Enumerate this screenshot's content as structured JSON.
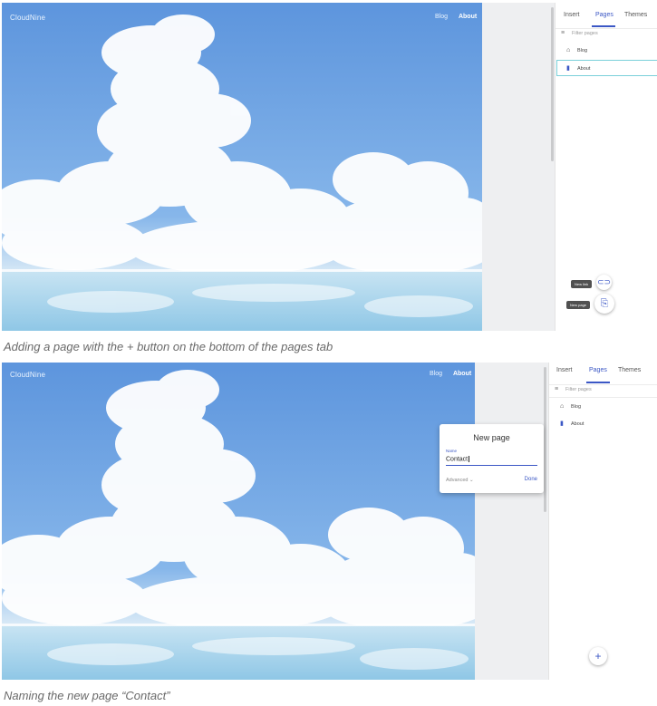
{
  "site": {
    "brand": "CloudNine",
    "nav": [
      "Blog",
      "About"
    ]
  },
  "panel": {
    "tabs": [
      "Insert",
      "Pages",
      "Themes"
    ],
    "filter_placeholder": "Filter pages",
    "pages": [
      {
        "label": "Blog",
        "icon": "home-icon"
      },
      {
        "label": "About",
        "icon": "document-icon"
      }
    ]
  },
  "step1": {
    "tooltips": {
      "new_link": "New link",
      "new_page": "New page"
    },
    "caption": "Adding a page with the + button on the bottom of the pages tab"
  },
  "step2": {
    "dialog": {
      "title": "New page",
      "field_label": "Name",
      "field_value": "Contact",
      "advanced": "Advanced",
      "done": "Done"
    },
    "fab": "+",
    "caption": "Naming the new page “Contact”"
  },
  "colors": {
    "accent": "#3b57c5",
    "selection_border": "#7ad0da",
    "sky": "#6a9fe0"
  }
}
